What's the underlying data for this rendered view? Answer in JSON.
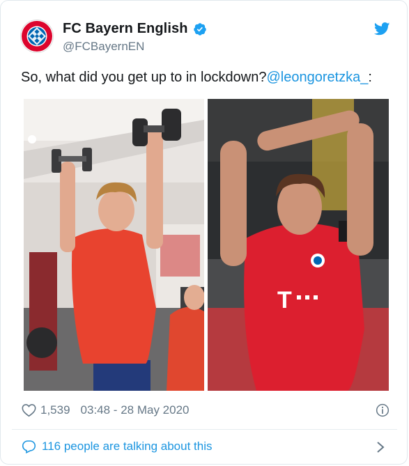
{
  "tweet": {
    "display_name": "FC Bayern English",
    "handle": "@FCBayernEN",
    "text": "So, what did you get up to in lockdown?",
    "mention": "@leongoretzka_",
    "text_suffix": ":",
    "likes": "1,539",
    "timestamp": "03:48 - 28 May 2020",
    "conversation": "116 people are talking about this"
  },
  "media": [
    {
      "description_icon": "photo-gym-dumbbell-press"
    },
    {
      "description_icon": "photo-stadium-stretch"
    }
  ],
  "icons": {
    "verified": "verified-badge-icon",
    "bird": "twitter-bird-icon",
    "heart": "heart-icon",
    "info": "info-icon",
    "bubble": "speech-bubble-icon",
    "chevron": "chevron-right-icon"
  },
  "colors": {
    "brand_blue": "#1da1f2",
    "link_blue": "#1b95e0",
    "bayern_red": "#dc052d",
    "muted": "#657786"
  }
}
